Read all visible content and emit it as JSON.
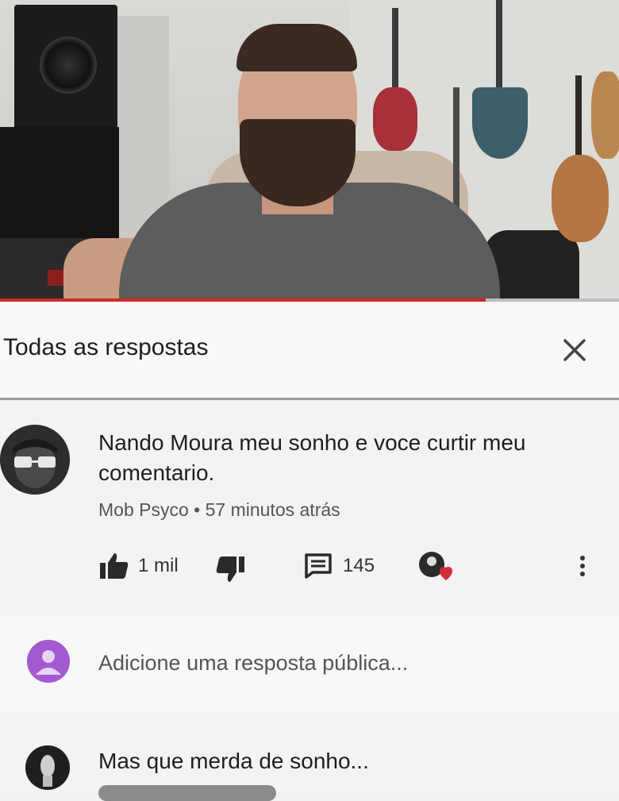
{
  "video": {
    "progress_fraction": 0.785,
    "colors": {
      "progress": "#d12a2a",
      "track": "#bdbdbd"
    }
  },
  "panel": {
    "title": "Todas as respostas",
    "close_icon": "close-icon"
  },
  "comment": {
    "text": "Nando Moura meu sonho e voce curtir meu comentario.",
    "author": "Mob Psyco",
    "separator": "•",
    "time": "57 minutos atrás",
    "likes": "1 mil",
    "replies": "145",
    "icons": [
      "thumbs-up-icon",
      "thumbs-down-icon",
      "reply-icon",
      "creator-heart-icon",
      "more-vert-icon"
    ]
  },
  "reply": {
    "placeholder": "Adicione uma resposta pública..."
  },
  "comment2": {
    "text": "Mas que merda de sonho..."
  }
}
